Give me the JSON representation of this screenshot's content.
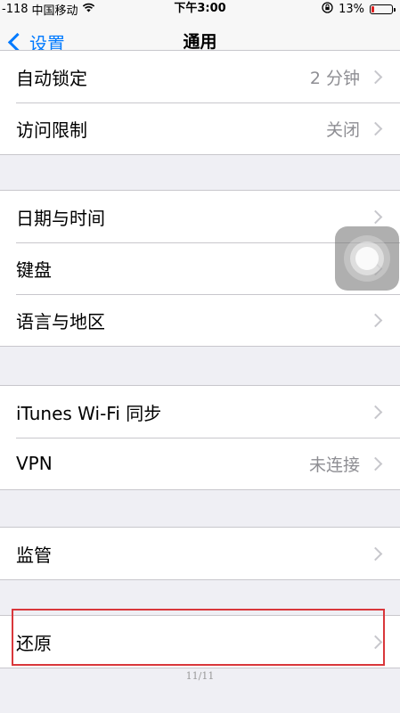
{
  "status_bar": {
    "signal": "-118",
    "carrier": "中国移动",
    "wifi_icon": "wifi-icon",
    "time": "下午3:00",
    "lock_icon": "orientation-lock-icon",
    "battery": "13%",
    "battery_level": 0.13
  },
  "nav": {
    "back_label": "设置",
    "title": "通用"
  },
  "groups": [
    {
      "rows": [
        {
          "label": "自动锁定",
          "value": "2 分钟"
        },
        {
          "label": "访问限制",
          "value": "关闭"
        }
      ]
    },
    {
      "rows": [
        {
          "label": "日期与时间",
          "value": ""
        },
        {
          "label": "键盘",
          "value": ""
        },
        {
          "label": "语言与地区",
          "value": ""
        }
      ]
    },
    {
      "rows": [
        {
          "label": "iTunes Wi-Fi 同步",
          "value": ""
        },
        {
          "label": "VPN",
          "value": "未连接"
        }
      ]
    },
    {
      "rows": [
        {
          "label": "监管",
          "value": ""
        }
      ]
    },
    {
      "rows": [
        {
          "label": "还原",
          "value": ""
        }
      ]
    }
  ],
  "page_indicator": "11/11",
  "colors": {
    "accent": "#007aff",
    "highlight": "#d9373b",
    "background": "#efeff4"
  }
}
